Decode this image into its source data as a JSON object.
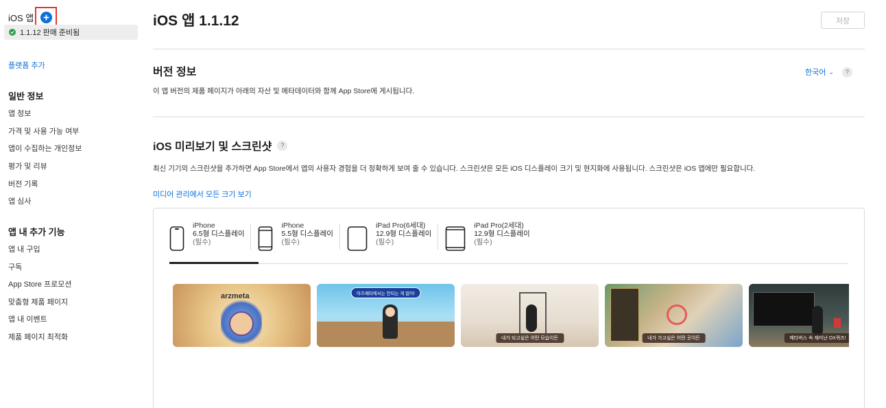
{
  "sidebar": {
    "ios_label": "iOS 앱",
    "status": "1.1.12 판매 준비됨",
    "add_platform": "플랫폼 추가",
    "general_heading": "일반 정보",
    "general_items": [
      "앱 정보",
      "가격 및 사용 가능 여부",
      "앱이 수집하는 개인정보",
      "평가 및 리뷰",
      "버전 기록",
      "앱 심사"
    ],
    "features_heading": "앱 내 추가 기능",
    "feature_items": [
      "앱 내 구입",
      "구독",
      "App Store 프로모션",
      "맞춤형 제품 페이지",
      "앱 내 이벤트",
      "제품 페이지 최적화"
    ]
  },
  "main": {
    "title": "iOS 앱 1.1.12",
    "save_label": "저장",
    "version_heading": "버전 정보",
    "version_desc": "이 앱 버전의 제품 페이지가 아래의 자산 및 메타데이터와 함께 App Store에 게시됩니다.",
    "language": "한국어",
    "help_glyph": "?",
    "preview_heading": "iOS 미리보기 및 스크린샷",
    "preview_desc": "최신 기기의 스크린샷을 추가하면 App Store에서 앱의 사용자 경험을 더 정확하게 보여 줄 수 있습니다. 스크린샷은 모든 iOS 디스플레이 크기 및 현지화에 사용됩니다. 스크린샷은 iOS 앱에만 필요합니다.",
    "media_link": "미디어 관리에서 모든 크기 보기",
    "tabs": [
      {
        "line1": "iPhone",
        "line2": "6.5형 디스플레이",
        "line3": "(필수)"
      },
      {
        "line1": "iPhone",
        "line2": "5.5형 디스플레이",
        "line3": "(필수)"
      },
      {
        "line1": "iPad Pro(6세대)",
        "line2": "12.9형 디스플레이",
        "line3": "(필수)"
      },
      {
        "line1": "iPad Pro(2세대)",
        "line2": "12.9형 디스플레이",
        "line3": "(필수)"
      }
    ],
    "screenshots": [
      {
        "brand": "arzmeta",
        "banner": "",
        "caption": ""
      },
      {
        "brand": "",
        "banner": "아즈메타에서는 안되는 게 없어!",
        "caption": ""
      },
      {
        "brand": "",
        "banner": "",
        "caption": "내가 되고싶은 어떤 모습이든"
      },
      {
        "brand": "",
        "banner": "",
        "caption": "내가 가고싶은 어떤 곳이든"
      },
      {
        "brand": "",
        "banner": "",
        "caption": "메타버스 속 재미난 OX퀴즈!"
      }
    ]
  },
  "colors": {
    "accent": "#0a6fd8",
    "success": "#2e9e4c",
    "highlight": "#e2332b"
  }
}
